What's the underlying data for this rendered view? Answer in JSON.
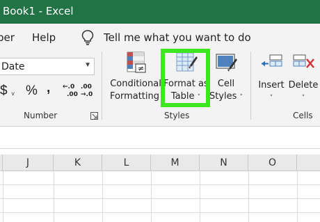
{
  "window": {
    "title": "Book1  -  Excel"
  },
  "tabs": [
    "per",
    "Help"
  ],
  "tell_me": {
    "text": "Tell me what you want to do",
    "icon": "lightbulb-icon"
  },
  "number_group": {
    "format_value": "Date",
    "currency_symbol": "$",
    "percent_symbol": "%",
    "comma_symbol": ",",
    "increase_decimal": {
      "top": "←.0",
      "bottom": ".00"
    },
    "decrease_decimal": {
      "top": ".00",
      "bottom": "→.0"
    },
    "label": "Number"
  },
  "styles_group": {
    "conditional_formatting": {
      "line1": "Conditional",
      "line2": "Formatting"
    },
    "format_as_table": {
      "line1": "Format as",
      "line2": "Table"
    },
    "cell_styles": {
      "line1": "Cell",
      "line2": "Styles"
    },
    "label": "Styles"
  },
  "cells_group": {
    "insert": "Insert",
    "delete": "Delete",
    "label": "Cells"
  },
  "caret": "˅",
  "columns": [
    "J",
    "K",
    "L",
    "M",
    "N",
    "O"
  ],
  "colors": {
    "title_bar": "#217346",
    "highlight": "#3ee621"
  }
}
